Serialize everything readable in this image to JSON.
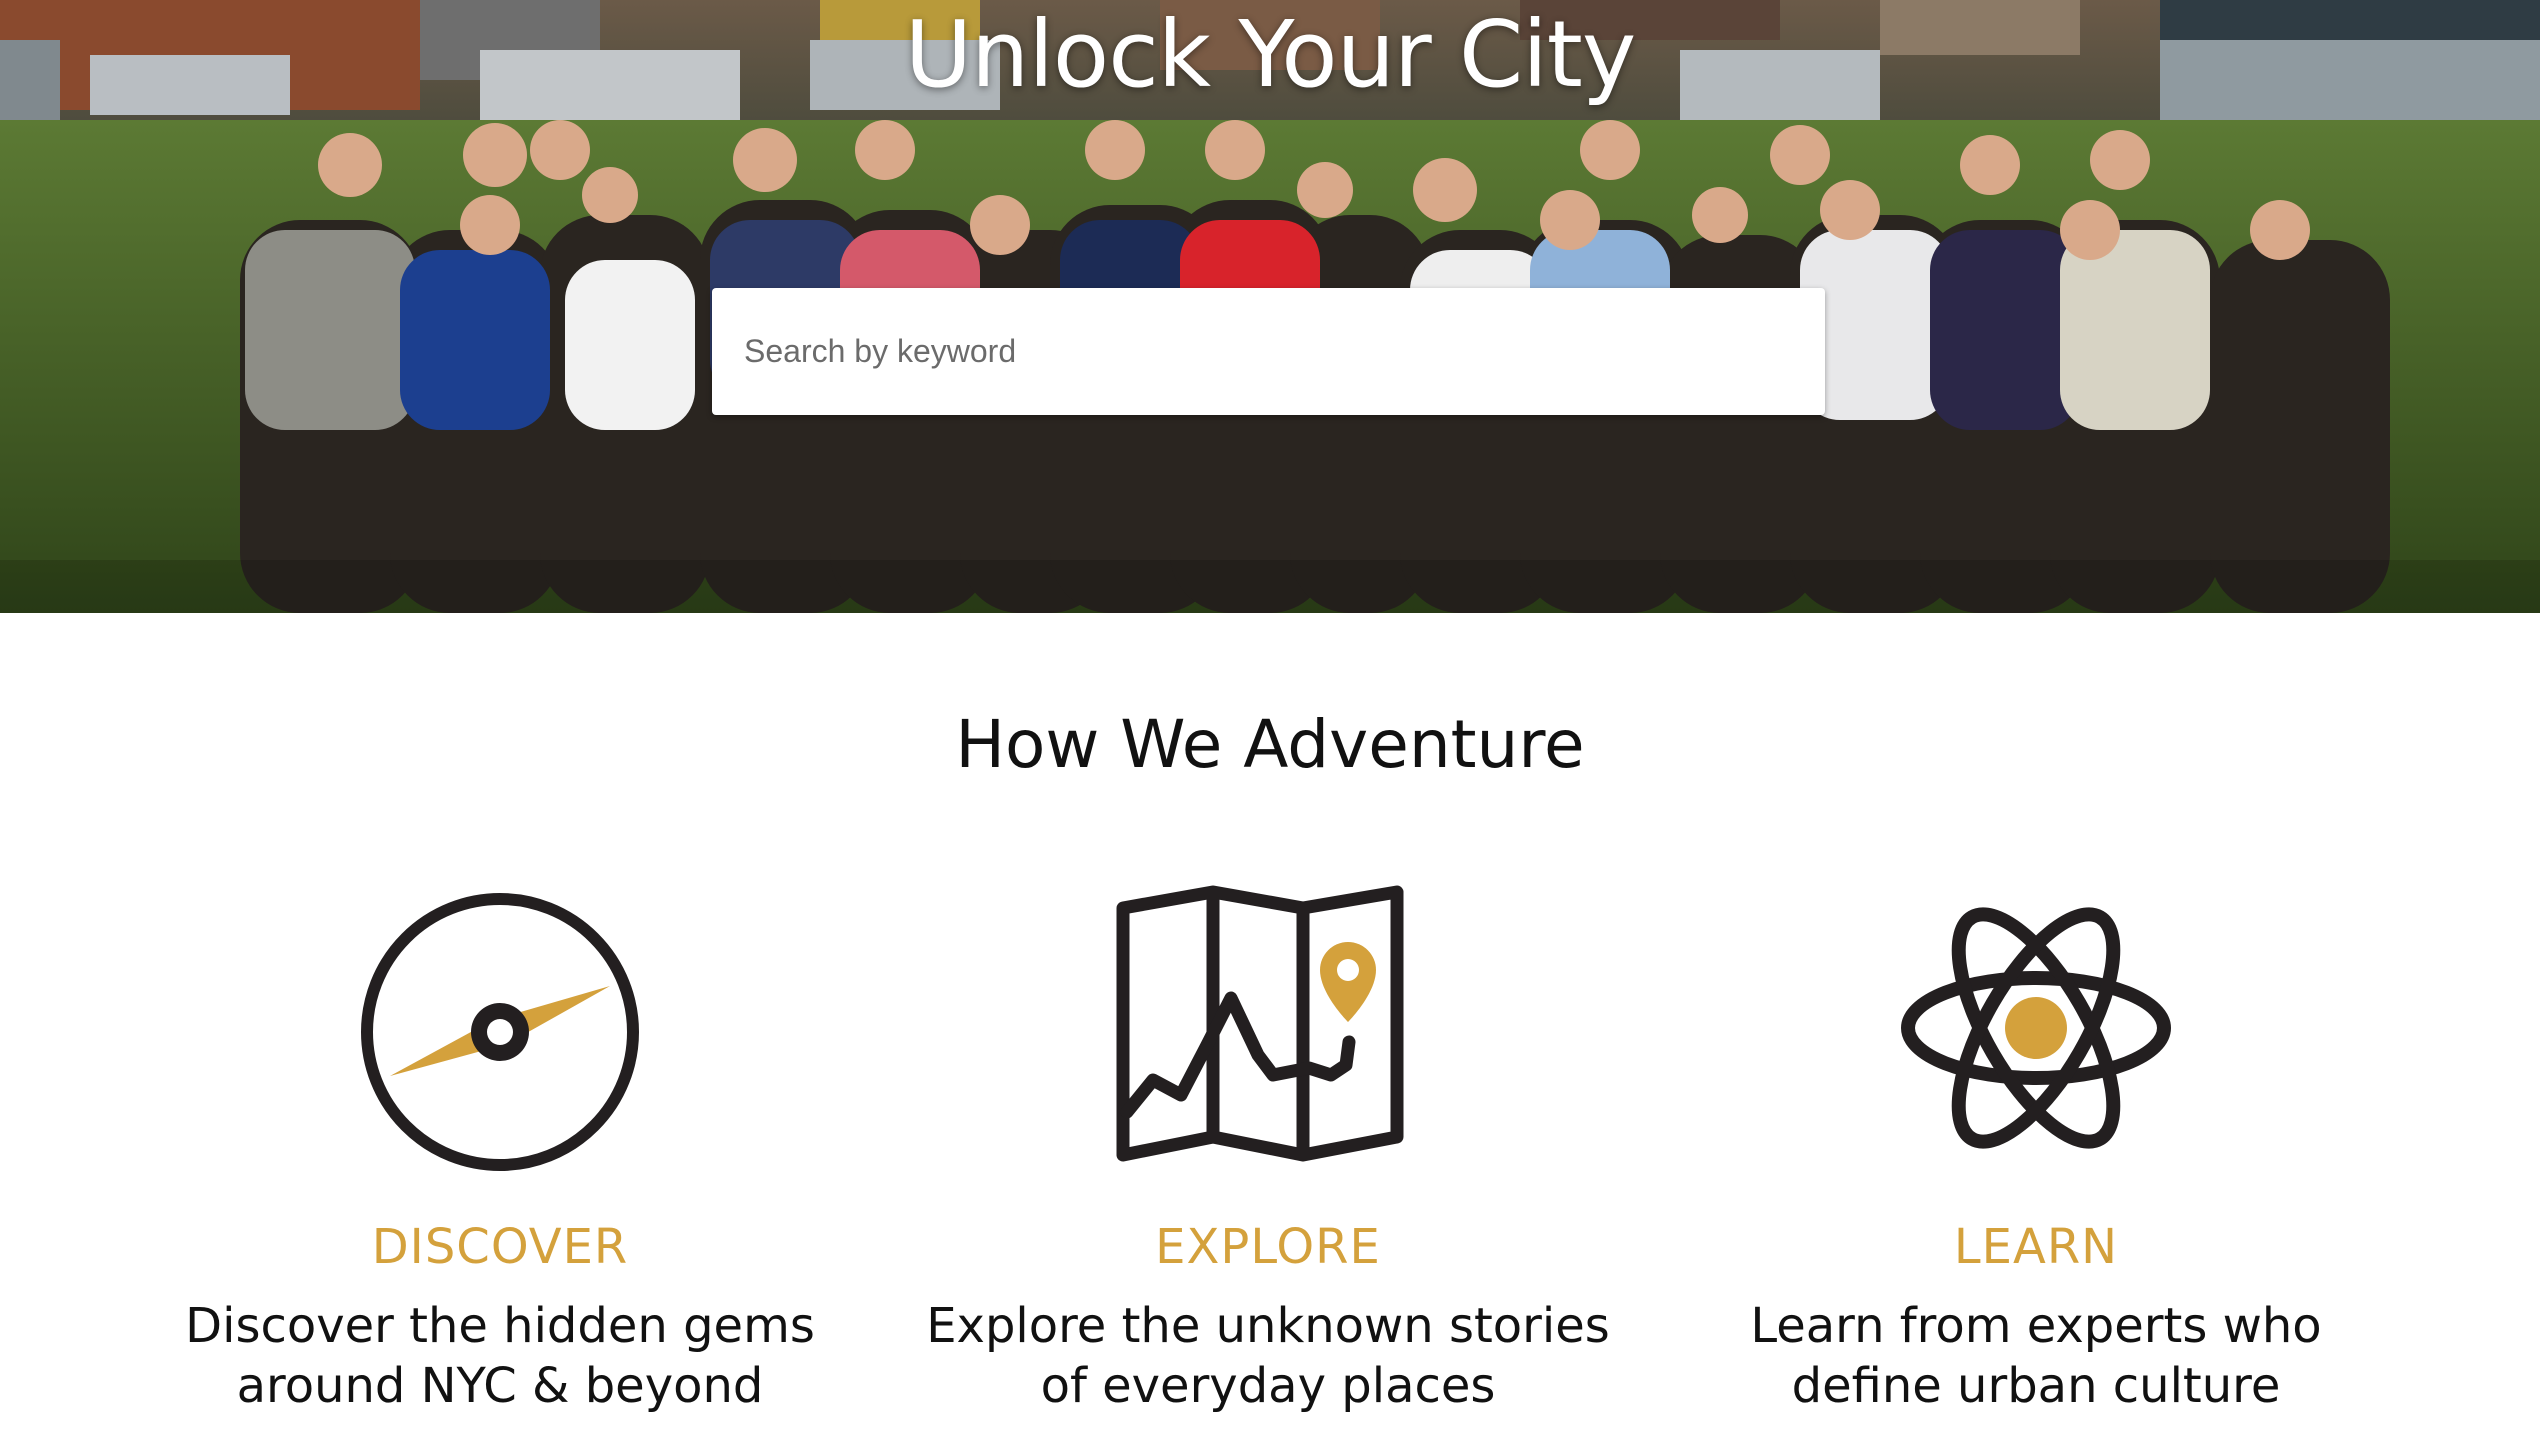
{
  "hero": {
    "title": "Unlock Your City",
    "search_placeholder": "Search by keyword",
    "image": "group-photo-on-green-rooftop"
  },
  "section": {
    "title": "How We Adventure",
    "items": [
      {
        "icon": "compass-icon",
        "heading": "DISCOVER",
        "text_line1": "Discover the hidden gems",
        "text_line2": "around NYC & beyond"
      },
      {
        "icon": "map-icon",
        "heading": "EXPLORE",
        "text_line1": "Explore the unknown stories",
        "text_line2": "of everyday places"
      },
      {
        "icon": "atom-icon",
        "heading": "LEARN",
        "text_line1": "Learn from experts who",
        "text_line2": "define urban culture"
      }
    ]
  },
  "colors": {
    "accent": "#d4a13c",
    "icon_stroke": "#231f20",
    "text": "#111111"
  }
}
